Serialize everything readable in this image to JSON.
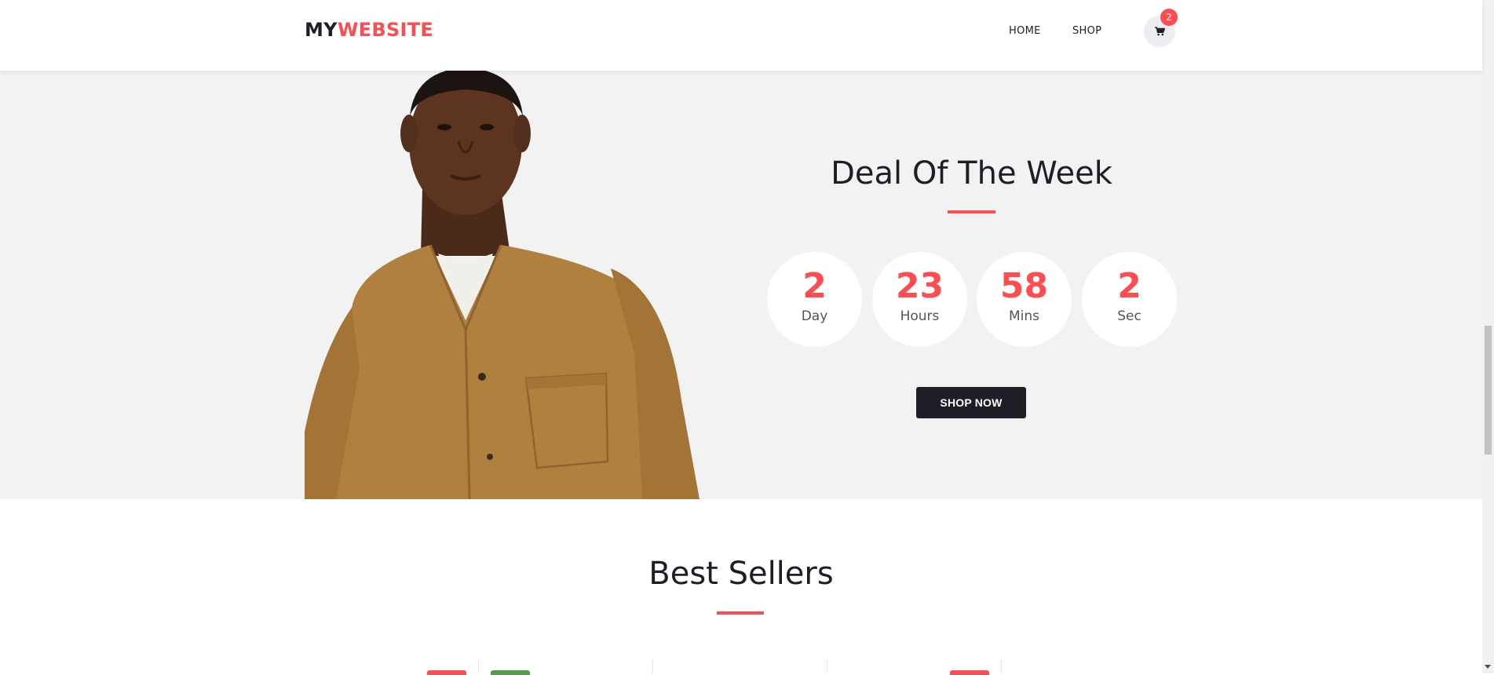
{
  "header": {
    "logo_part1": "MY",
    "logo_part2": "WEBSITE",
    "nav": [
      {
        "label": "HOME"
      },
      {
        "label": "SHOP"
      }
    ],
    "cart_count": "2"
  },
  "deal": {
    "title": "Deal Of The Week",
    "timer": [
      {
        "value": "2",
        "label": "Day"
      },
      {
        "value": "23",
        "label": "Hours"
      },
      {
        "value": "58",
        "label": "Mins"
      },
      {
        "value": "2",
        "label": "Sec"
      }
    ],
    "button_label": "SHOP NOW"
  },
  "best_sellers": {
    "title": "Best Sellers"
  },
  "colors": {
    "accent": "#fe4c50",
    "dark": "#1e1e27",
    "sale_green": "#51a042",
    "deal_bg": "#f2f2f2"
  }
}
